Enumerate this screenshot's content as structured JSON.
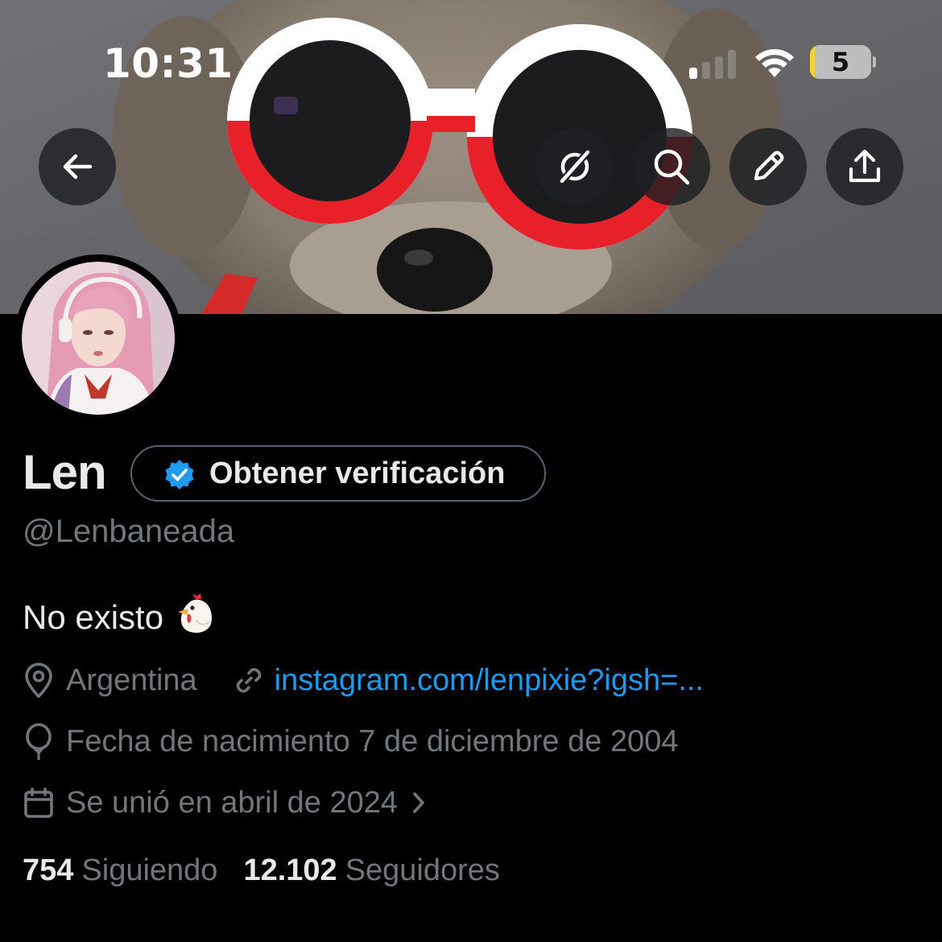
{
  "status_bar": {
    "time": "10:31",
    "battery_level": "5"
  },
  "header": {
    "icons": [
      "back-arrow-icon",
      "grok-icon",
      "search-icon",
      "pencil-icon",
      "share-icon"
    ]
  },
  "profile": {
    "name": "Len",
    "verify_button_label": "Obtener verificación",
    "handle": "@Lenbaneada",
    "bio": "No existo",
    "bio_emoji": "🐔",
    "location": "Argentina",
    "website": "instagram.com/lenpixie?igsh=...",
    "birth_date": "Fecha de nacimiento 7 de diciembre de 2004",
    "joined": "Se unió en abril de 2024",
    "following_count": "754",
    "following_label": "Siguiendo",
    "followers_count": "12.102",
    "followers_label": "Seguidores"
  },
  "colors": {
    "background": "#000000",
    "primary_text": "#e7e9ea",
    "secondary_text": "#71767b",
    "link": "#1d9bf0",
    "verified_badge": "#1d9bf0"
  }
}
